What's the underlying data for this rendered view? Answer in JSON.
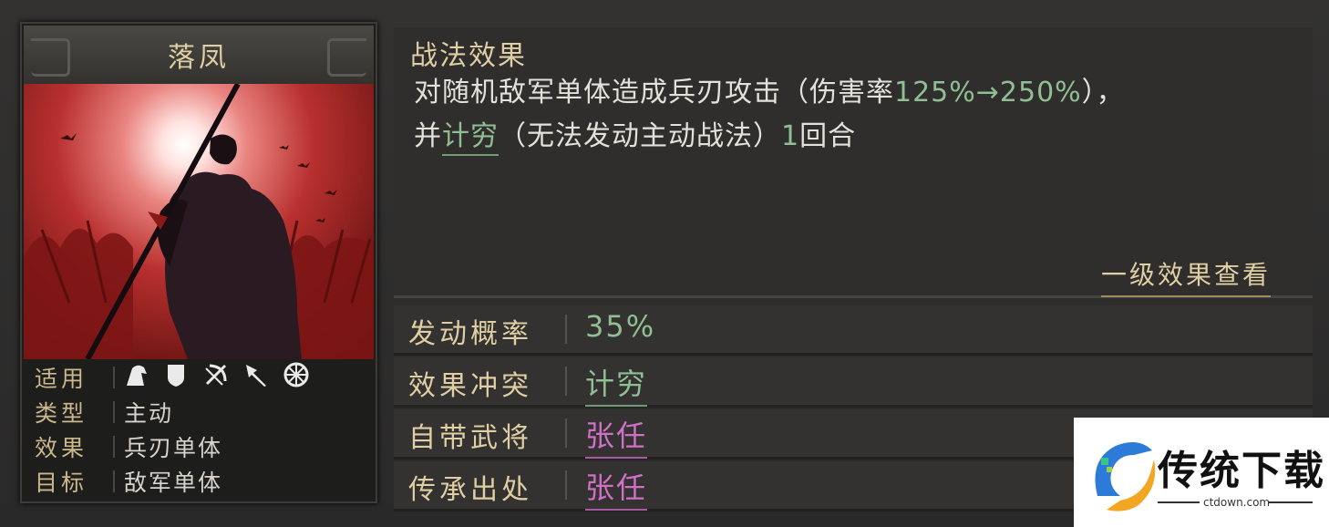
{
  "card": {
    "title": "落凤",
    "attrs": [
      {
        "key": "适用",
        "value": ""
      },
      {
        "key": "类型",
        "value": "主动"
      },
      {
        "key": "效果",
        "value": "兵刃单体"
      },
      {
        "key": "目标",
        "value": "敌军单体"
      }
    ],
    "unit_icons": [
      "cavalry-icon",
      "shield-icon",
      "bow-icon",
      "spear-icon",
      "wheel-icon"
    ]
  },
  "effect": {
    "title": "战法效果",
    "line1_a": "对随机敌军单体造成兵刃攻击（伤害率",
    "line1_rate": "125%→250%",
    "line1_b": "），",
    "line2_a": "并",
    "line2_term": "计穷",
    "line2_b": "（无法发动主动战法）",
    "line2_num": "1",
    "line2_c": "回合",
    "level_link": "一级效果查看"
  },
  "rows": [
    {
      "label": "发动概率",
      "value": "35%"
    },
    {
      "label": "效果冲突",
      "value": "计穷"
    },
    {
      "label": "自带武将",
      "value": "张任"
    },
    {
      "label": "传承出处",
      "value": "张任"
    }
  ],
  "watermark": {
    "name": "传统下载",
    "url": "ctdown.com"
  },
  "colors": {
    "gold": "#e0cfa4",
    "green": "#8fbf93",
    "purple": "#d070c8"
  }
}
